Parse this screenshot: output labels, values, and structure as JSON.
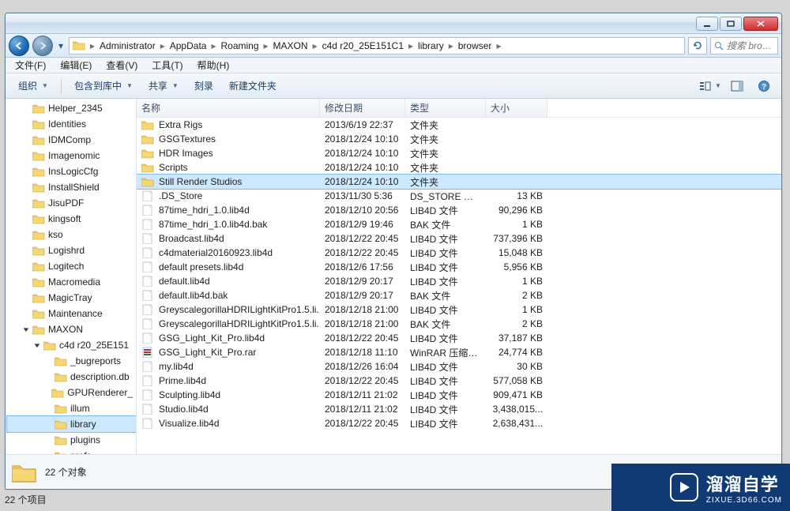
{
  "window": {
    "caption_buttons": {
      "min": "minimize",
      "max": "maximize",
      "close": "close"
    }
  },
  "addressbar": {
    "breadcrumbs": [
      "Administrator",
      "AppData",
      "Roaming",
      "MAXON",
      "c4d r20_25E151C1",
      "library",
      "browser"
    ],
    "refresh_alt": "refresh"
  },
  "search": {
    "placeholder": "搜索 brow..."
  },
  "menubar": {
    "items": [
      "文件(F)",
      "编辑(E)",
      "查看(V)",
      "工具(T)",
      "帮助(H)"
    ]
  },
  "toolbar": {
    "organize": "组织",
    "include": "包含到库中",
    "share": "共享",
    "burn": "刻录",
    "newfolder": "新建文件夹"
  },
  "tree": [
    {
      "indent": 1,
      "tw": "",
      "label": "Helper_2345"
    },
    {
      "indent": 1,
      "tw": "",
      "label": "Identities"
    },
    {
      "indent": 1,
      "tw": "",
      "label": "IDMComp"
    },
    {
      "indent": 1,
      "tw": "",
      "label": "Imagenomic"
    },
    {
      "indent": 1,
      "tw": "",
      "label": "InsLogicCfg"
    },
    {
      "indent": 1,
      "tw": "",
      "label": "InstallShield"
    },
    {
      "indent": 1,
      "tw": "",
      "label": "JisuPDF"
    },
    {
      "indent": 1,
      "tw": "",
      "label": "kingsoft"
    },
    {
      "indent": 1,
      "tw": "",
      "label": "kso"
    },
    {
      "indent": 1,
      "tw": "",
      "label": "Logishrd"
    },
    {
      "indent": 1,
      "tw": "",
      "label": "Logitech"
    },
    {
      "indent": 1,
      "tw": "",
      "label": "Macromedia"
    },
    {
      "indent": 1,
      "tw": "",
      "label": "MagicTray"
    },
    {
      "indent": 1,
      "tw": "",
      "label": "Maintenance"
    },
    {
      "indent": 1,
      "tw": "d",
      "label": "MAXON"
    },
    {
      "indent": 2,
      "tw": "d",
      "label": "c4d r20_25E151"
    },
    {
      "indent": 3,
      "tw": "",
      "label": "_bugreports"
    },
    {
      "indent": 3,
      "tw": "",
      "label": "description.db"
    },
    {
      "indent": 3,
      "tw": "",
      "label": "GPURenderer_"
    },
    {
      "indent": 3,
      "tw": "",
      "label": "illum"
    },
    {
      "indent": 3,
      "tw": "",
      "label": "library",
      "sel": true
    },
    {
      "indent": 3,
      "tw": "",
      "label": "plugins"
    },
    {
      "indent": 3,
      "tw": "",
      "label": "prefs"
    }
  ],
  "columns": {
    "name": "名称",
    "date": "修改日期",
    "type": "类型",
    "size": "大小"
  },
  "files": [
    {
      "ico": "folder",
      "name": "Extra Rigs",
      "date": "2013/6/19 22:37",
      "type": "文件夹",
      "size": ""
    },
    {
      "ico": "folder",
      "name": "GSGTextures",
      "date": "2018/12/24 10:10",
      "type": "文件夹",
      "size": ""
    },
    {
      "ico": "folder",
      "name": "HDR Images",
      "date": "2018/12/24 10:10",
      "type": "文件夹",
      "size": ""
    },
    {
      "ico": "folder",
      "name": "Scripts",
      "date": "2018/12/24 10:10",
      "type": "文件夹",
      "size": ""
    },
    {
      "ico": "folder",
      "name": "Still Render Studios",
      "date": "2018/12/24 10:10",
      "type": "文件夹",
      "size": "",
      "sel": true
    },
    {
      "ico": "file",
      "name": ".DS_Store",
      "date": "2013/11/30 5:36",
      "type": "DS_STORE 文件",
      "size": "13 KB"
    },
    {
      "ico": "file",
      "name": "87time_hdri_1.0.lib4d",
      "date": "2018/12/10 20:56",
      "type": "LIB4D 文件",
      "size": "90,296 KB"
    },
    {
      "ico": "file",
      "name": "87time_hdri_1.0.lib4d.bak",
      "date": "2018/12/9 19:46",
      "type": "BAK 文件",
      "size": "1 KB"
    },
    {
      "ico": "file",
      "name": "Broadcast.lib4d",
      "date": "2018/12/22 20:45",
      "type": "LIB4D 文件",
      "size": "737,396 KB"
    },
    {
      "ico": "file",
      "name": "c4dmaterial20160923.lib4d",
      "date": "2018/12/22 20:45",
      "type": "LIB4D 文件",
      "size": "15,048 KB"
    },
    {
      "ico": "file",
      "name": "default presets.lib4d",
      "date": "2018/12/6 17:56",
      "type": "LIB4D 文件",
      "size": "5,956 KB"
    },
    {
      "ico": "file",
      "name": "default.lib4d",
      "date": "2018/12/9 20:17",
      "type": "LIB4D 文件",
      "size": "1 KB"
    },
    {
      "ico": "file",
      "name": "default.lib4d.bak",
      "date": "2018/12/9 20:17",
      "type": "BAK 文件",
      "size": "2 KB"
    },
    {
      "ico": "file",
      "name": "GreyscalegorillaHDRILightKitPro1.5.li...",
      "date": "2018/12/18 21:00",
      "type": "LIB4D 文件",
      "size": "1 KB"
    },
    {
      "ico": "file",
      "name": "GreyscalegorillaHDRILightKitPro1.5.li...",
      "date": "2018/12/18 21:00",
      "type": "BAK 文件",
      "size": "2 KB"
    },
    {
      "ico": "file",
      "name": "GSG_Light_Kit_Pro.lib4d",
      "date": "2018/12/22 20:45",
      "type": "LIB4D 文件",
      "size": "37,187 KB"
    },
    {
      "ico": "rar",
      "name": "GSG_Light_Kit_Pro.rar",
      "date": "2018/12/18 11:10",
      "type": "WinRAR 压缩文件",
      "size": "24,774 KB"
    },
    {
      "ico": "file",
      "name": "my.lib4d",
      "date": "2018/12/26 16:04",
      "type": "LIB4D 文件",
      "size": "30 KB"
    },
    {
      "ico": "file",
      "name": "Prime.lib4d",
      "date": "2018/12/22 20:45",
      "type": "LIB4D 文件",
      "size": "577,058 KB"
    },
    {
      "ico": "file",
      "name": "Sculpting.lib4d",
      "date": "2018/12/11 21:02",
      "type": "LIB4D 文件",
      "size": "909,471 KB"
    },
    {
      "ico": "file",
      "name": "Studio.lib4d",
      "date": "2018/12/11 21:02",
      "type": "LIB4D 文件",
      "size": "3,438,015..."
    },
    {
      "ico": "file",
      "name": "Visualize.lib4d",
      "date": "2018/12/22 20:45",
      "type": "LIB4D 文件",
      "size": "2,638,431..."
    }
  ],
  "status": {
    "count": "22 个对象"
  },
  "bottom_status": "22 个项目",
  "watermark": {
    "brand": "溜溜自学",
    "url": "ZIXUE.3D66.COM"
  }
}
